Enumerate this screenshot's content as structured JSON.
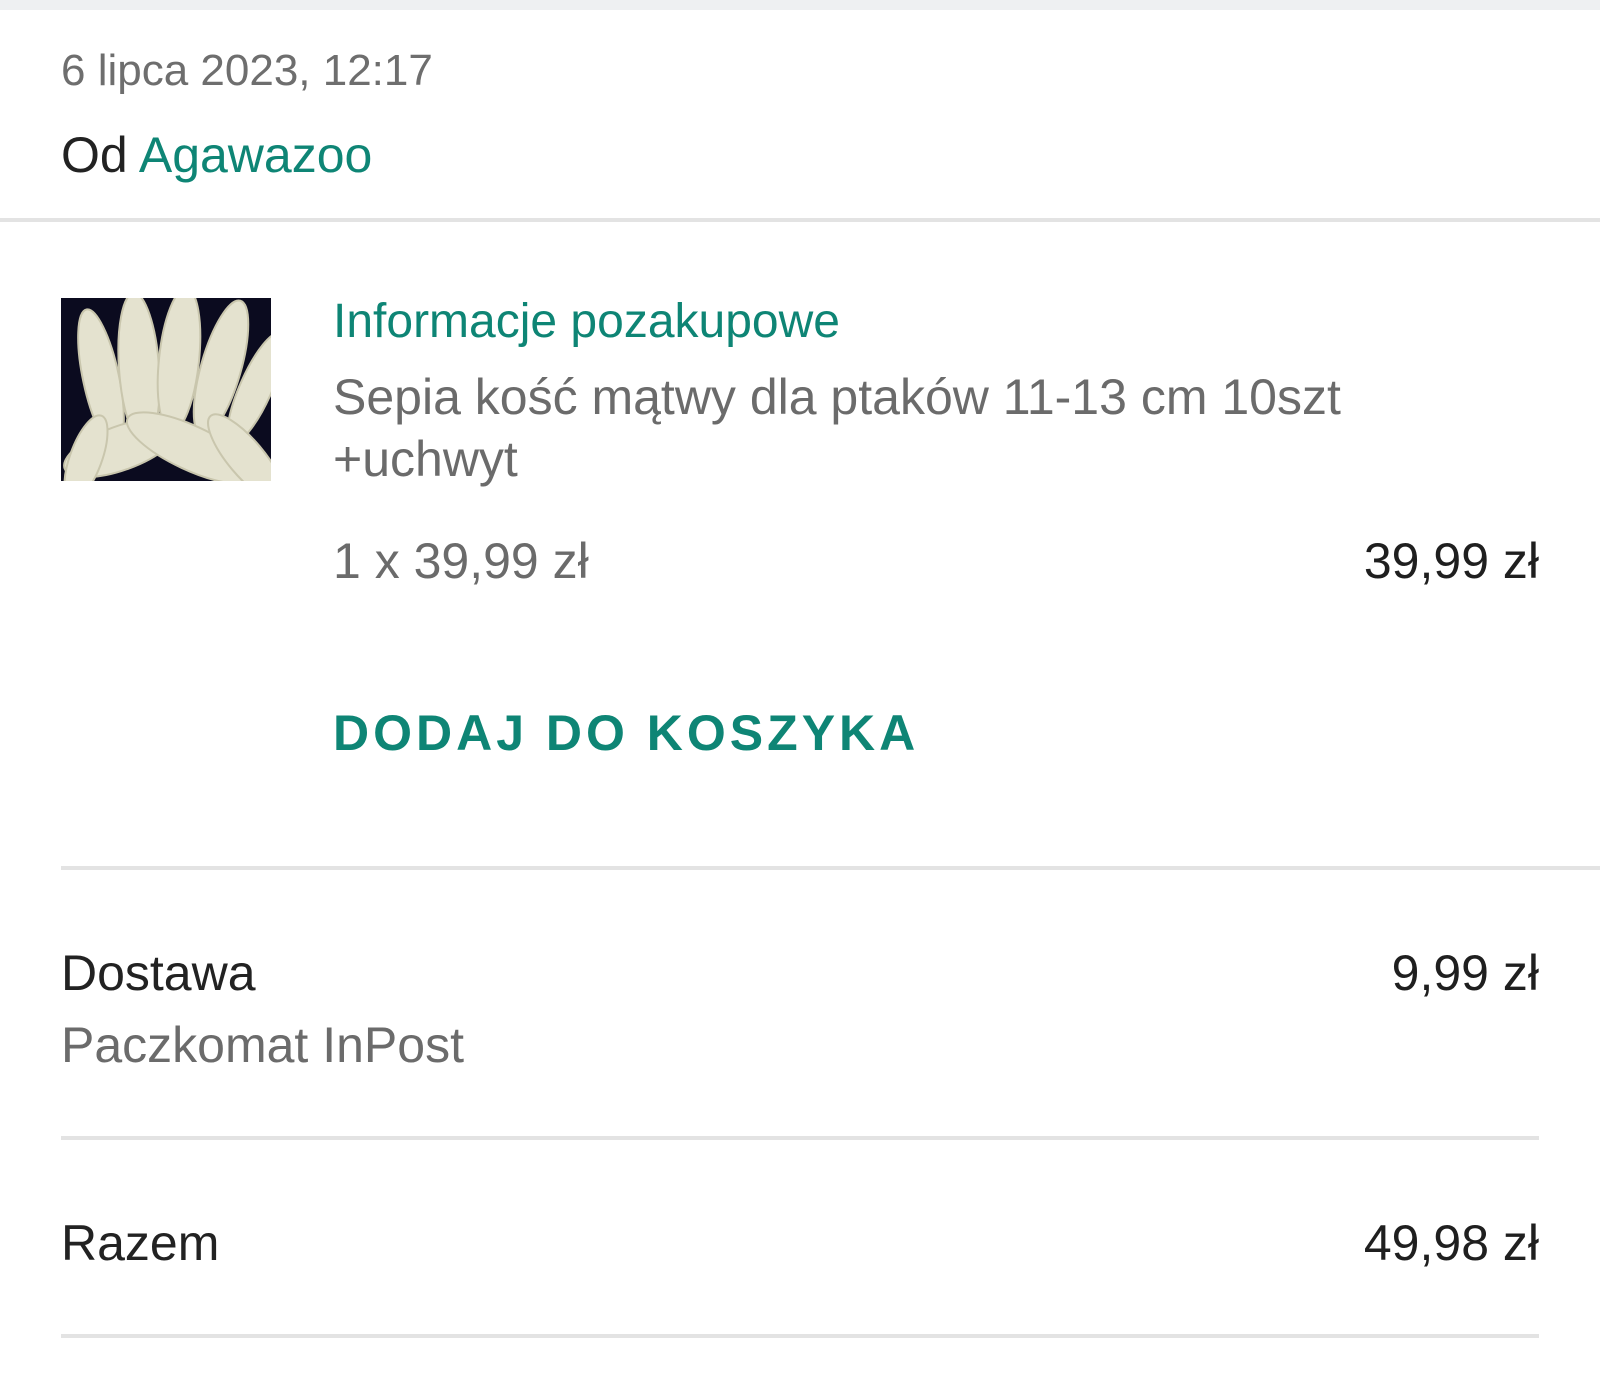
{
  "order": {
    "date": "6 lipca 2023, 12:17",
    "seller_prefix": "Od",
    "seller_name": "Agawazoo"
  },
  "item": {
    "image_icon": "product-thumbnail-cuttlebones",
    "info_link": "Informacje pozakupowe",
    "title": "Sepia kość mątwy dla ptaków 11-13 cm 10szt +uchwyt",
    "quantity_price": "1 x 39,99 zł",
    "line_total": "39,99 zł",
    "add_to_cart_label": "DODAJ DO KOSZYKA"
  },
  "delivery": {
    "label": "Dostawa",
    "method": "Paczkomat InPost",
    "price": "9,99 zł"
  },
  "total": {
    "label": "Razem",
    "value": "49,98 zł"
  },
  "colors": {
    "accent": "#0e8575",
    "text_dark": "#222222",
    "text_grey": "#6b6b6b",
    "divider": "#e3e3e3"
  }
}
